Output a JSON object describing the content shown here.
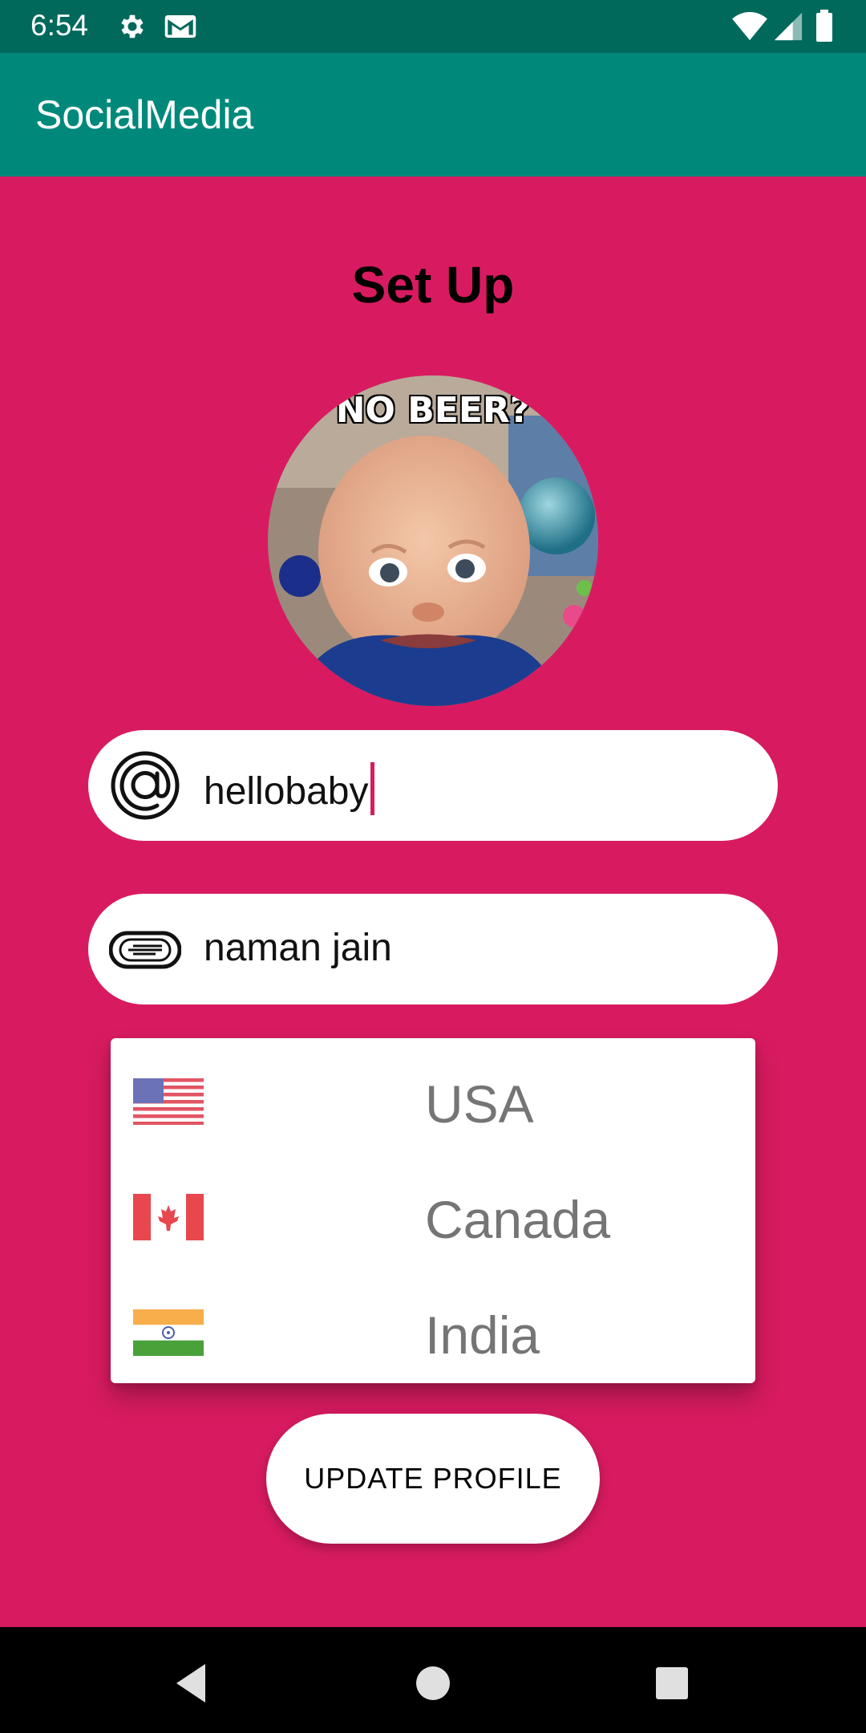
{
  "status_bar": {
    "time": "6:54",
    "icons": [
      "gear-icon",
      "gmail-icon",
      "wifi-icon",
      "signal-icon",
      "battery-icon"
    ]
  },
  "app_bar": {
    "title": "SocialMedia"
  },
  "setup": {
    "heading": "Set Up",
    "avatar_caption": "NO BEER?",
    "username": {
      "value": "hellobaby",
      "icon": "at-sign-icon"
    },
    "full_name": {
      "value": "naman jain",
      "icon": "name-tag-icon"
    },
    "country_options": [
      {
        "label": "USA",
        "flag": "usa-flag-icon"
      },
      {
        "label": "Canada",
        "flag": "canada-flag-icon"
      },
      {
        "label": "India",
        "flag": "india-flag-icon"
      }
    ],
    "update_button": "UPDATE PROFILE"
  },
  "colors": {
    "background": "#d81b60",
    "app_bar": "#00897b",
    "status_bar": "#00695c",
    "caret": "#d81b60"
  }
}
